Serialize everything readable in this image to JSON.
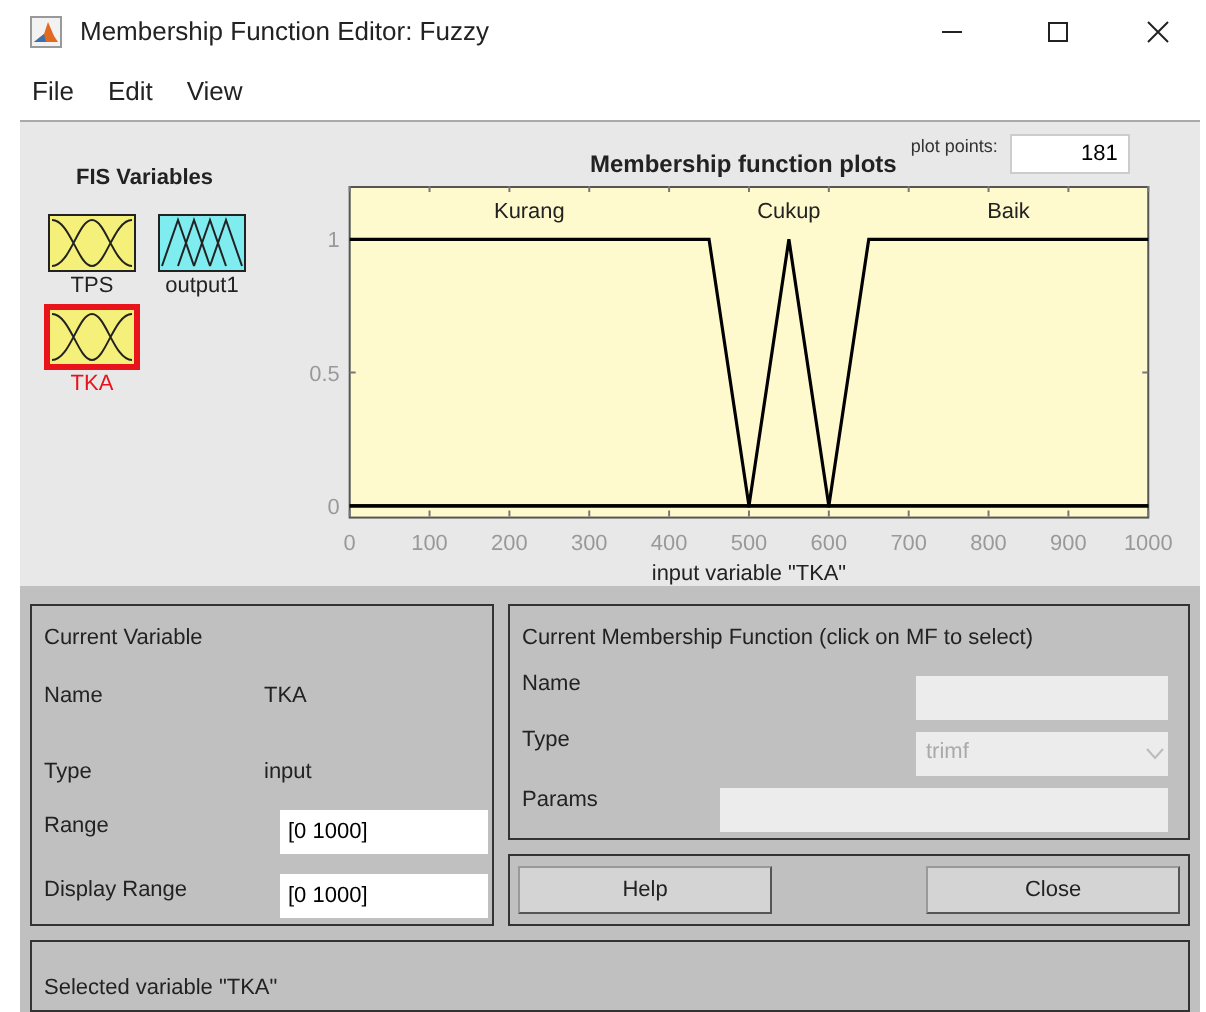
{
  "window": {
    "title": "Membership Function Editor: Fuzzy"
  },
  "menu": [
    "File",
    "Edit",
    "View"
  ],
  "fis_variables": {
    "title": "FIS Variables",
    "items": [
      {
        "label": "TPS",
        "kind": "input",
        "selected": false
      },
      {
        "label": "output1",
        "kind": "output",
        "selected": false
      },
      {
        "label": "TKA",
        "kind": "input",
        "selected": true
      }
    ]
  },
  "plot": {
    "title": "Membership function plots",
    "plot_points_label": "plot points:",
    "plot_points": "181",
    "chart_data": {
      "type": "line",
      "xlabel": "input variable \"TKA\"",
      "x": [
        0,
        450,
        500,
        550,
        600,
        650,
        1000
      ],
      "series": [
        {
          "name": "Kurang",
          "color": "#000000",
          "values": [
            1,
            1,
            0,
            0,
            0,
            0,
            0
          ]
        },
        {
          "name": "Cukup",
          "color": "#000000",
          "values": [
            0,
            0,
            0,
            1,
            0,
            0,
            0
          ]
        },
        {
          "name": "Baik",
          "color": "#000000",
          "values": [
            0,
            0,
            0,
            0,
            0,
            1,
            1
          ]
        }
      ],
      "xlim": [
        0,
        1000
      ],
      "ylim": [
        -0.04,
        1.2
      ],
      "xticks": [
        0,
        100,
        200,
        300,
        400,
        500,
        600,
        700,
        800,
        900,
        1000
      ],
      "yticks": [
        0,
        {
          "value": 0.5,
          "label": "0.5"
        },
        1
      ]
    }
  },
  "current_variable": {
    "title": "Current Variable",
    "name_label": "Name",
    "name": "TKA",
    "type_label": "Type",
    "type": "input",
    "range_label": "Range",
    "range": "[0 1000]",
    "display_range_label": "Display Range",
    "display_range": "[0 1000]"
  },
  "current_mf": {
    "title": "Current Membership Function (click on MF to select)",
    "name_label": "Name",
    "type_label": "Type",
    "type": "trimf",
    "type_disabled": true,
    "params_label": "Params"
  },
  "buttons": [
    "Help",
    "Close"
  ],
  "status": "Selected variable \"TKA\""
}
